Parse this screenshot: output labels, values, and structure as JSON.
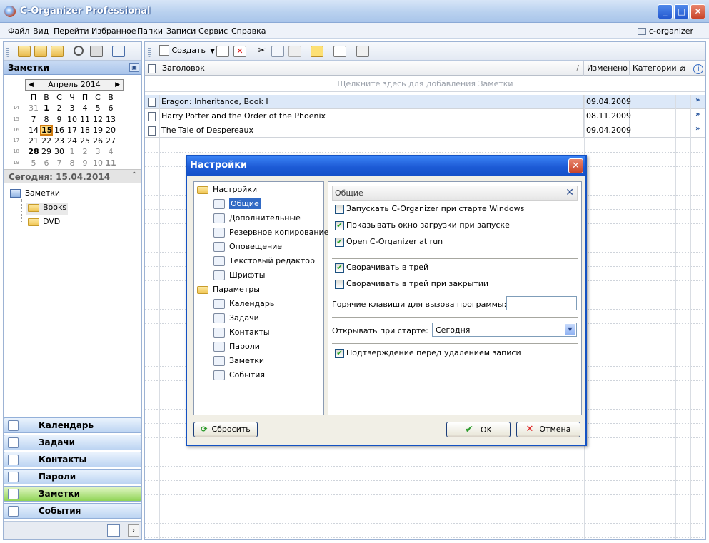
{
  "window": {
    "title": "C-Organizer Professional"
  },
  "menu": [
    "Файл",
    "Вид",
    "Перейти",
    "Избранное",
    "Папки",
    "Записи",
    "Сервис",
    "Справка"
  ],
  "profile": "c-organizer",
  "left": {
    "panel_title": "Заметки",
    "calendar": {
      "month": "Апрель 2014",
      "weekdays": [
        "П",
        "В",
        "С",
        "Ч",
        "П",
        "С",
        "В"
      ],
      "weeks": [
        {
          "wk": "14",
          "days": [
            "31",
            "1",
            "2",
            "3",
            "4",
            "5",
            "6"
          ]
        },
        {
          "wk": "15",
          "days": [
            "7",
            "8",
            "9",
            "10",
            "11",
            "12",
            "13"
          ]
        },
        {
          "wk": "16",
          "days": [
            "14",
            "15",
            "16",
            "17",
            "18",
            "19",
            "20"
          ]
        },
        {
          "wk": "17",
          "days": [
            "21",
            "22",
            "23",
            "24",
            "25",
            "26",
            "27"
          ]
        },
        {
          "wk": "18",
          "days": [
            "28",
            "29",
            "30",
            "1",
            "2",
            "3",
            "4"
          ]
        },
        {
          "wk": "19",
          "days": [
            "5",
            "6",
            "7",
            "8",
            "9",
            "10",
            "11"
          ]
        }
      ]
    },
    "today": "Сегодня: 15.04.2014",
    "tree": {
      "root": "Заметки",
      "children": [
        "Books",
        "DVD"
      ]
    },
    "nav": [
      "Календарь",
      "Задачи",
      "Контакты",
      "Пароли",
      "Заметки",
      "События"
    ]
  },
  "toolbar": {
    "create": "Создать"
  },
  "columns": {
    "title": "Заголовок",
    "modified": "Изменено",
    "categories": "Категории"
  },
  "hint": "Щелкните здесь для добавления Заметки",
  "rows": [
    {
      "title": "Eragon: Inheritance, Book I",
      "date": "09.04.2009"
    },
    {
      "title": "Harry Potter and the Order of the Phoenix",
      "date": "08.11.2009"
    },
    {
      "title": "The Tale of Despereaux",
      "date": "09.04.2009"
    }
  ],
  "dialog": {
    "title": "Настройки",
    "tree": {
      "g1": "Настройки",
      "g1items": [
        "Общие",
        "Дополнительные",
        "Резервное копирование",
        "Оповещение",
        "Текстовый редактор",
        "Шрифты"
      ],
      "g2": "Параметры",
      "g2items": [
        "Календарь",
        "Задачи",
        "Контакты",
        "Пароли",
        "Заметки",
        "События"
      ]
    },
    "panel_title": "Общие",
    "checks": [
      {
        "label": "Запускать C-Organizer при старте Windows",
        "checked": false
      },
      {
        "label": "Показывать окно загрузки при запуске",
        "checked": true
      },
      {
        "label": "Open C-Organizer at run",
        "checked": true
      },
      {
        "label": "Сворачивать в трей",
        "checked": true
      },
      {
        "label": "Сворачивать в трей при закрытии",
        "checked": false
      }
    ],
    "hotkey_label": "Горячие клавиши для вызова программы:",
    "hotkey_value": "",
    "start_label": "Открывать при старте:",
    "start_value": "Сегодня",
    "confirm": {
      "label": "Подтверждение перед удалением записи",
      "checked": true
    },
    "reset": "Сбросить",
    "ok": "OK",
    "cancel": "Отмена"
  }
}
